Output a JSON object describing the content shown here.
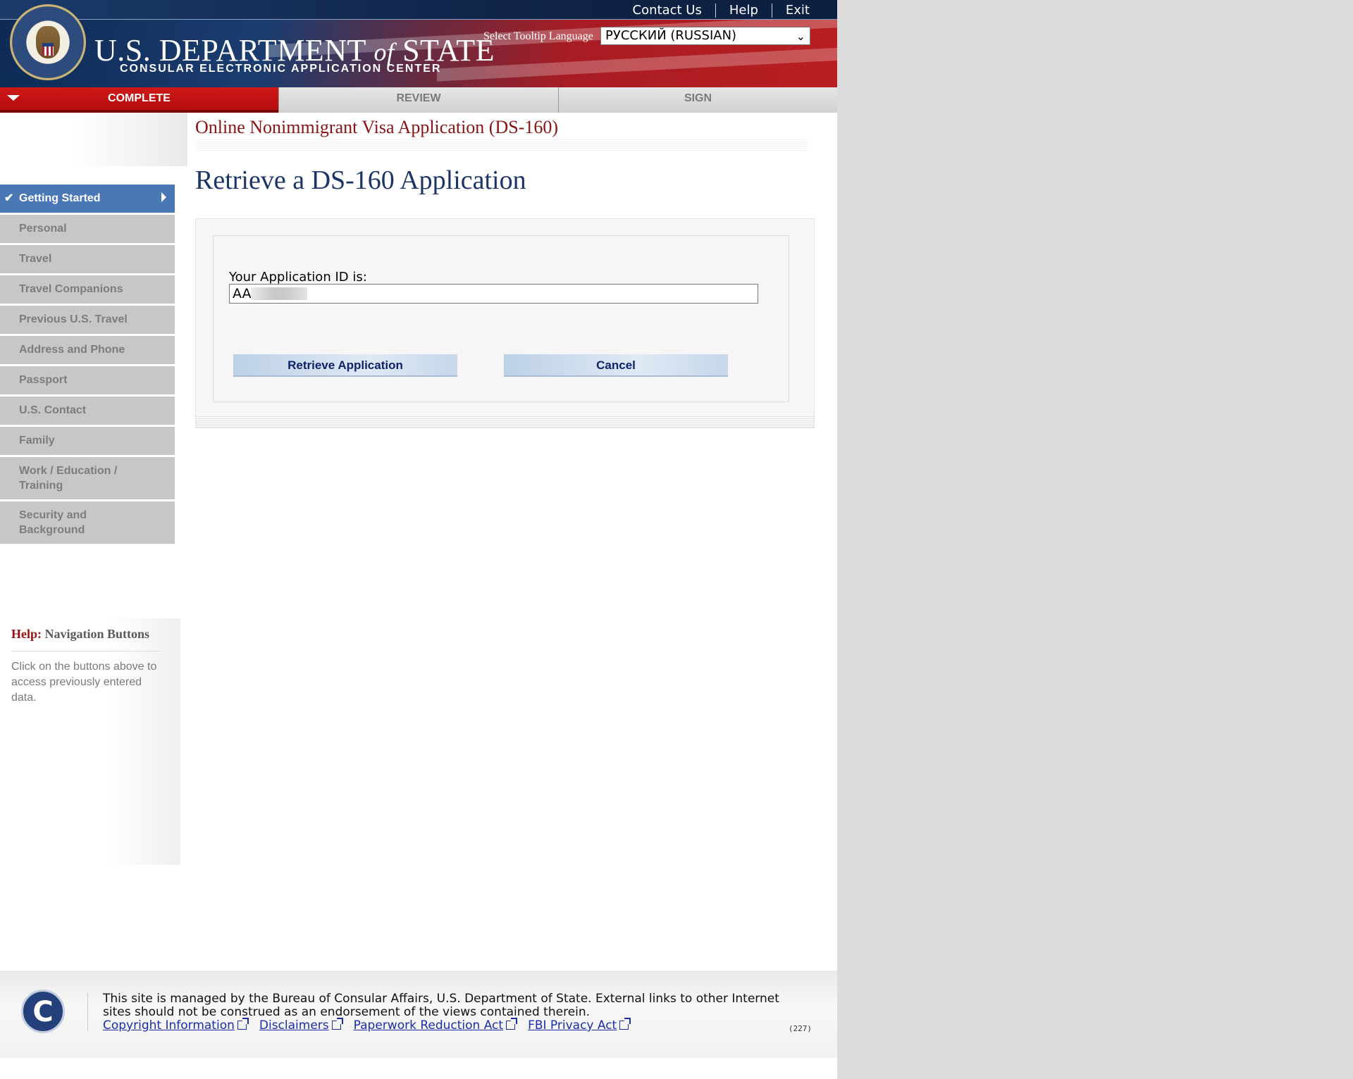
{
  "header": {
    "top_links": [
      "Contact Us",
      "Help",
      "Exit"
    ],
    "dept_prefix": "U.S. DEPARTMENT",
    "dept_of": "of",
    "dept_suffix": "STATE",
    "dept_subtitle": "CONSULAR ELECTRONIC APPLICATION CENTER",
    "tooltip_language_label": "Select Tooltip Language",
    "tooltip_language_value": "РУССКИЙ (RUSSIAN)"
  },
  "tabs": [
    {
      "label": "COMPLETE",
      "active": true
    },
    {
      "label": "REVIEW",
      "active": false
    },
    {
      "label": "SIGN",
      "active": false
    }
  ],
  "sidebar": {
    "items": [
      {
        "label": "Getting Started",
        "active": true
      },
      {
        "label": "Personal"
      },
      {
        "label": "Travel"
      },
      {
        "label": "Travel Companions"
      },
      {
        "label": "Previous U.S. Travel"
      },
      {
        "label": "Address and Phone"
      },
      {
        "label": "Passport"
      },
      {
        "label": "U.S. Contact"
      },
      {
        "label": "Family"
      },
      {
        "label": "Work / Education / Training"
      },
      {
        "label": "Security and Background"
      }
    ],
    "help": {
      "label": "Help:",
      "title": "Navigation Buttons",
      "text": "Click on the buttons above to access previously entered data."
    }
  },
  "main": {
    "app_title": "Online Nonimmigrant Visa Application (DS-160)",
    "heading": "Retrieve a DS-160 Application",
    "id_label": "Your Application ID is:",
    "id_value": "AA",
    "retrieve_button": "Retrieve Application",
    "cancel_button": "Cancel"
  },
  "footer": {
    "text": "This site is managed by the Bureau of Consular Affairs, U.S. Department of State. External links to other Internet sites should not be construed as an endorsement of the views contained therein.",
    "links": [
      "Copyright Information",
      "Disclaimers",
      "Paperwork Reduction Act",
      "FBI Privacy Act"
    ],
    "code": "(227)",
    "logo_letter": "C"
  },
  "colors": {
    "active_tab": "#c41212",
    "active_nav": "#4a78b6",
    "nav_bg": "#c7c7c7",
    "heading": "#1d3566",
    "app_title": "#8a1414"
  }
}
